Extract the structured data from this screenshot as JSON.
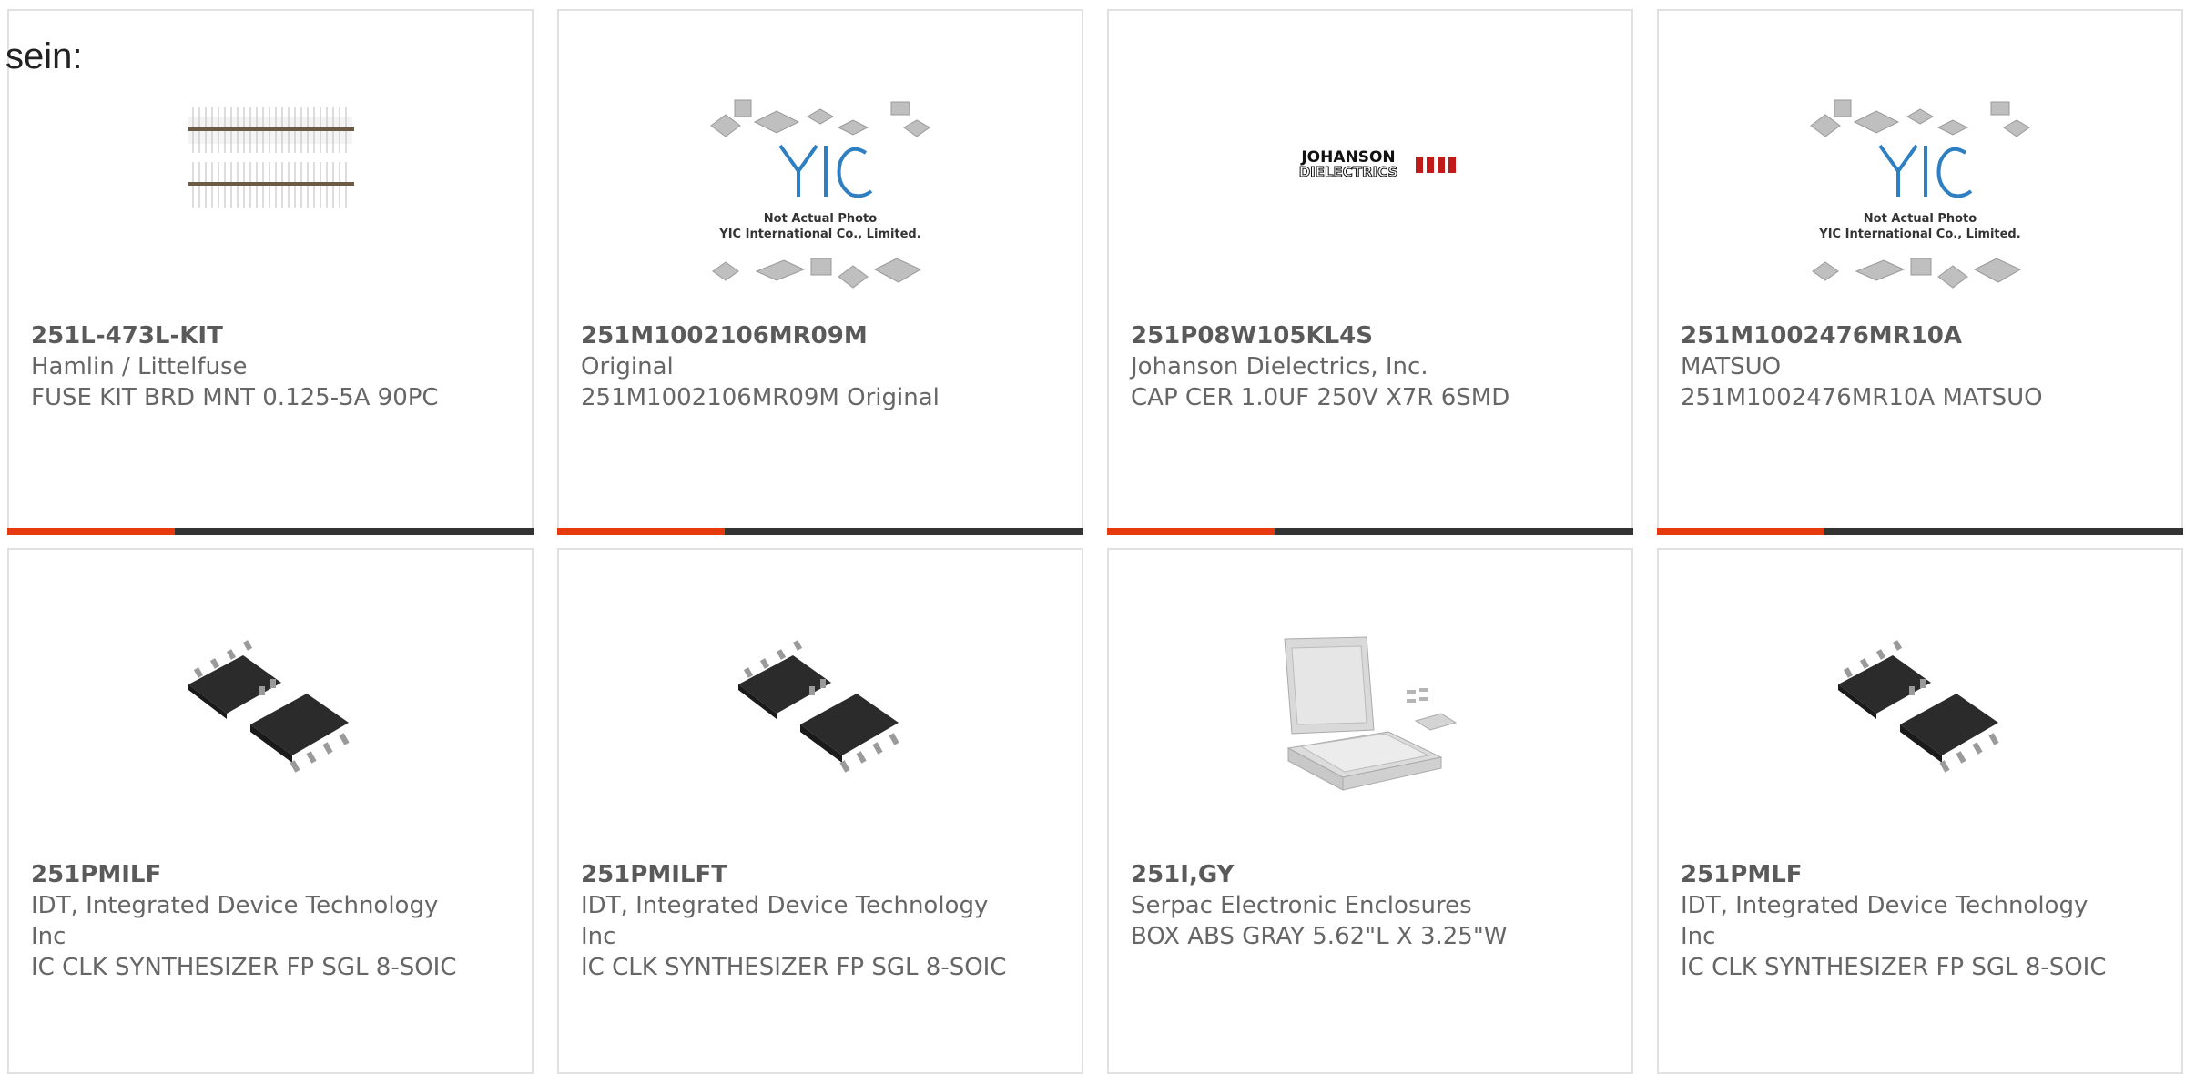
{
  "intro": "sein:",
  "products": [
    {
      "part": "251L-473L-KIT",
      "maker": "Hamlin / Littelfuse",
      "desc": "FUSE KIT BRD MNT 0.125-5A 90PC",
      "image": "fuse-kit"
    },
    {
      "part": "251M1002106MR09M",
      "maker": "Original",
      "desc": "251M1002106MR09M Original",
      "image": "yic-placeholder",
      "image_text": [
        "Not Actual Photo",
        "YIC International Co., Limited."
      ]
    },
    {
      "part": "251P08W105KL4S",
      "maker": "Johanson Dielectrics, Inc.",
      "desc": "CAP CER 1.0UF 250V X7R 6SMD",
      "image": "johanson-logo",
      "image_text": [
        "JOHANSON",
        "DIELECTRICS"
      ]
    },
    {
      "part": "251M1002476MR10A",
      "maker": "MATSUO",
      "desc": "251M1002476MR10A MATSUO",
      "image": "yic-placeholder",
      "image_text": [
        "Not Actual Photo",
        "YIC International Co., Limited."
      ]
    },
    {
      "part": "251PMILF",
      "maker": "IDT, Integrated Device Technology Inc",
      "desc": "IC CLK SYNTHESIZER FP SGL 8-SOIC",
      "image": "soic-chip"
    },
    {
      "part": "251PMILFT",
      "maker": "IDT, Integrated Device Technology Inc",
      "desc": "IC CLK SYNTHESIZER FP SGL 8-SOIC",
      "image": "soic-chip"
    },
    {
      "part": "251I,GY",
      "maker": "Serpac Electronic Enclosures",
      "desc": "BOX ABS GRAY 5.62\"L X 3.25\"W",
      "image": "enclosure-box"
    },
    {
      "part": "251PMLF",
      "maker": "IDT, Integrated Device Technology Inc",
      "desc": "IC CLK SYNTHESIZER FP SGL 8-SOIC",
      "image": "soic-chip"
    }
  ],
  "colors": {
    "accent": "#e63a0e",
    "bar": "#333333",
    "border": "#e1e1e1"
  }
}
